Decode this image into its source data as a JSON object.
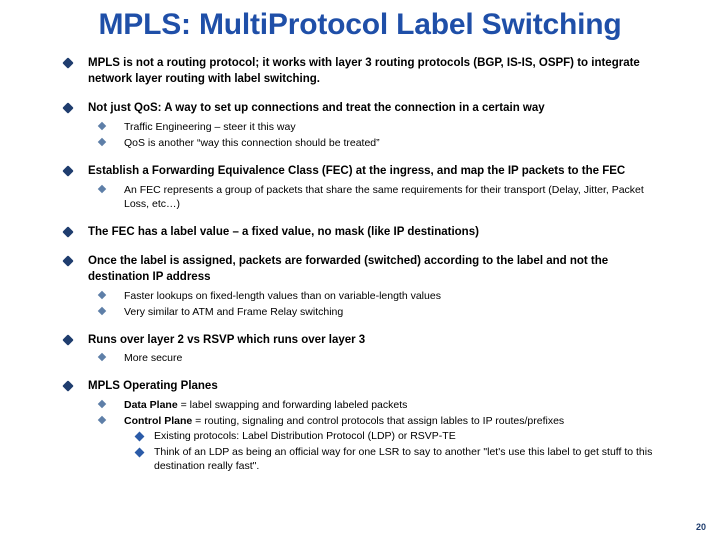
{
  "slide": {
    "title": "MPLS: MultiProtocol Label Switching",
    "page_number": "20",
    "colors": {
      "title": "#1F4FA8",
      "bullet_level1": "#1F3D6E",
      "bullet_level2": "#5E7FA8",
      "bullet_level3": "#2B5BA8",
      "text": "#000000",
      "background": "#FFFFFF"
    },
    "bullets": {
      "b1": "MPLS is not a routing protocol; it works with layer 3 routing protocols (BGP, IS-IS, OSPF) to integrate network layer routing with label switching.",
      "b2": "Not just QoS: A way to set up connections and treat the connection in a certain way",
      "b2_s1": "Traffic Engineering – steer it this way",
      "b2_s2": "QoS is another “way this connection should be treated”",
      "b3": "Establish a Forwarding Equivalence Class (FEC) at the ingress, and map the IP packets to the FEC",
      "b3_s1": "An FEC represents a group of packets that share the same requirements for their transport (Delay, Jitter, Packet Loss, etc…)",
      "b4": "The FEC has a label value – a fixed value, no mask (like IP destinations)",
      "b5": "Once the label is assigned, packets are forwarded (switched) according to the label and not the destination IP address",
      "b5_s1": "Faster lookups on fixed-length values than on variable-length values",
      "b5_s2": "Very similar to ATM and Frame Relay switching",
      "b6": "Runs over layer 2 vs RSVP which runs over layer 3",
      "b6_s1": "More secure",
      "b7": "MPLS Operating Planes",
      "b7_s1_lead": "Data Plane",
      "b7_s1_rest": " = label swapping and forwarding labeled packets",
      "b7_s2_lead": "Control Plane",
      "b7_s2_rest": " = routing, signaling and control protocols that assign lables to IP routes/prefixes",
      "b7_s2_t1": "Existing protocols: Label Distribution Protocol (LDP) or RSVP-TE",
      "b7_s2_t2": "Think of an LDP as being an official way for one LSR to say to another \"let's use this label to get stuff to this destination really fast\"."
    }
  }
}
